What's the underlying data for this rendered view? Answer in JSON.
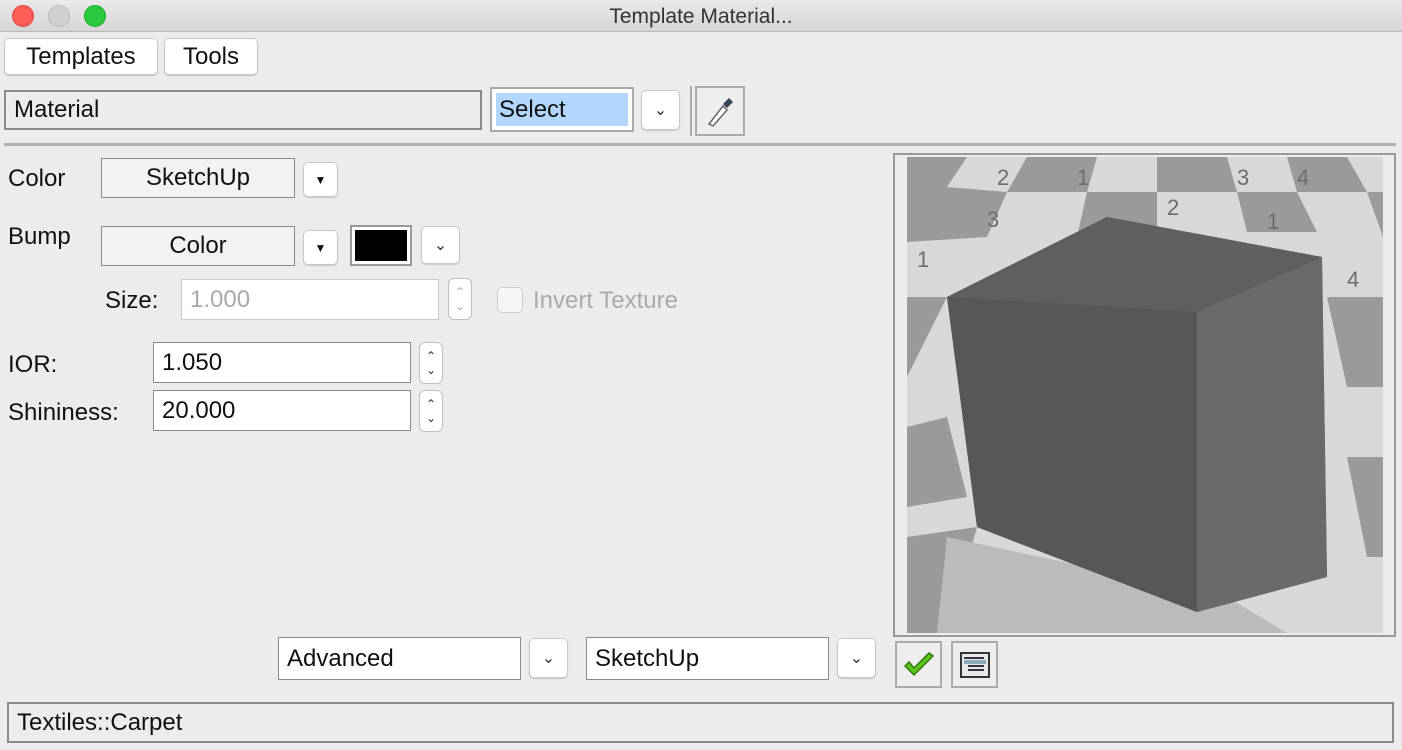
{
  "window": {
    "title": "Template Material..."
  },
  "tabs": [
    {
      "label": "Templates"
    },
    {
      "label": "Tools"
    }
  ],
  "material": {
    "name": "Material",
    "select_value": "Select"
  },
  "color": {
    "label": "Color",
    "value": "SketchUp"
  },
  "bump": {
    "label": "Bump",
    "value": "Color",
    "swatch_color": "#000000"
  },
  "size": {
    "label": "Size:",
    "value": "1.000",
    "disabled": true
  },
  "invert": {
    "label": "Invert Texture",
    "checked": false,
    "disabled": true
  },
  "ior": {
    "label": "IOR:",
    "value": "1.050"
  },
  "shininess": {
    "label": "Shininess:",
    "value": "20.000"
  },
  "bottom": {
    "mode": "Advanced",
    "renderer": "SketchUp"
  },
  "preview": {
    "checker_numbers": [
      "1",
      "2",
      "3",
      "4",
      "1",
      "2",
      "3",
      "4",
      "1"
    ]
  },
  "status": {
    "text": "Textiles::Carpet"
  },
  "icons": {
    "eyedropper": "eyedropper-icon",
    "apply": "checkmark-icon",
    "list": "list-icon"
  },
  "colors": {
    "select_highlight": "#b4d7fe",
    "check_green": "#5cc21c"
  }
}
